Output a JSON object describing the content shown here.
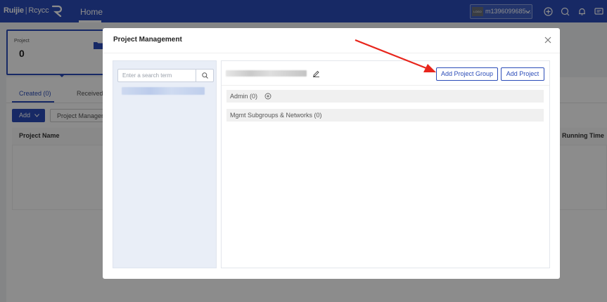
{
  "topbar": {
    "brand": "Ruijie",
    "brand_sub": "Rcycc",
    "nav_home": "Home",
    "account_logo": "LOGO",
    "account_name": "m1396099685...",
    "icons": [
      "add-circle-icon",
      "search-icon",
      "bell-icon",
      "message-icon"
    ],
    "bg_color": "#2b4cb8"
  },
  "background": {
    "card_label": "Project",
    "card_value": "0",
    "tabs": [
      "Created (0)",
      "Received("
    ],
    "add_label": "Add",
    "project_manager_label": "Project Manager",
    "col_project_name": "Project Name",
    "col_running_time": "Running Time"
  },
  "modal": {
    "title": "Project Management",
    "search_placeholder": "Enter a search term",
    "search_value": "",
    "buttons": {
      "add_project_group": "Add Project Group",
      "add_project": "Add Project"
    },
    "rows": [
      {
        "label": "Admin (0)"
      },
      {
        "label": "Mgmt Subgroups & Networks (0)"
      }
    ]
  },
  "colors": {
    "accent": "#2b4cb8",
    "annotation_arrow": "#e8251c"
  }
}
